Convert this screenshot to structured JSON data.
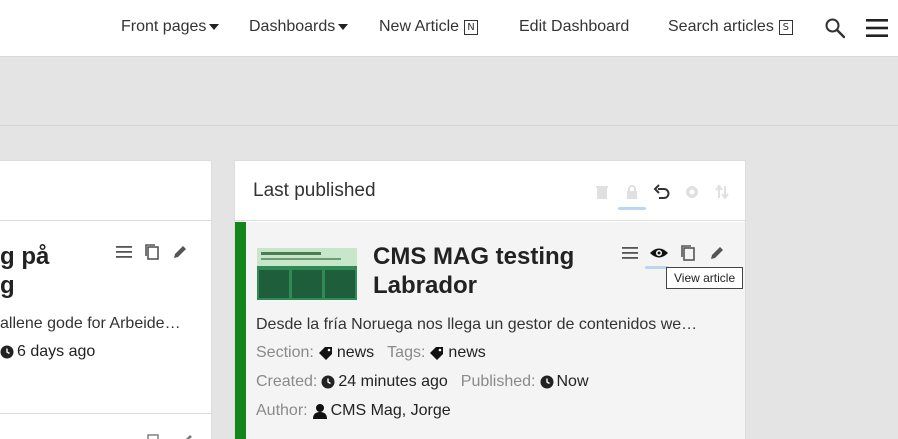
{
  "nav": {
    "front_pages": "Front pages",
    "dashboards": "Dashboards",
    "new_article": "New Article",
    "new_article_key": "N",
    "edit_dashboard": "Edit Dashboard",
    "search_articles": "Search articles",
    "search_articles_key": "S"
  },
  "left_card": {
    "title_line1": "g på",
    "title_line2": "g",
    "excerpt": "allene gode for Arbeide…",
    "time": "6 days ago"
  },
  "right_card": {
    "title": "Last published",
    "article": {
      "title": "CMS MAG testing Labrador",
      "excerpt": "Desde la fría Noruega nos llega un gestor de contenidos we…",
      "section_label": "Section:",
      "section_value": "news",
      "tags_label": "Tags:",
      "tags_value": "news",
      "created_label": "Created:",
      "created_value": "24 minutes ago",
      "published_label": "Published:",
      "published_value": "Now",
      "author_label": "Author:",
      "author_value": "CMS Mag, Jorge",
      "tooltip": "View article"
    }
  },
  "colors": {
    "accent_green": "#12861a",
    "tab_highlight": "#bcd6ee"
  }
}
